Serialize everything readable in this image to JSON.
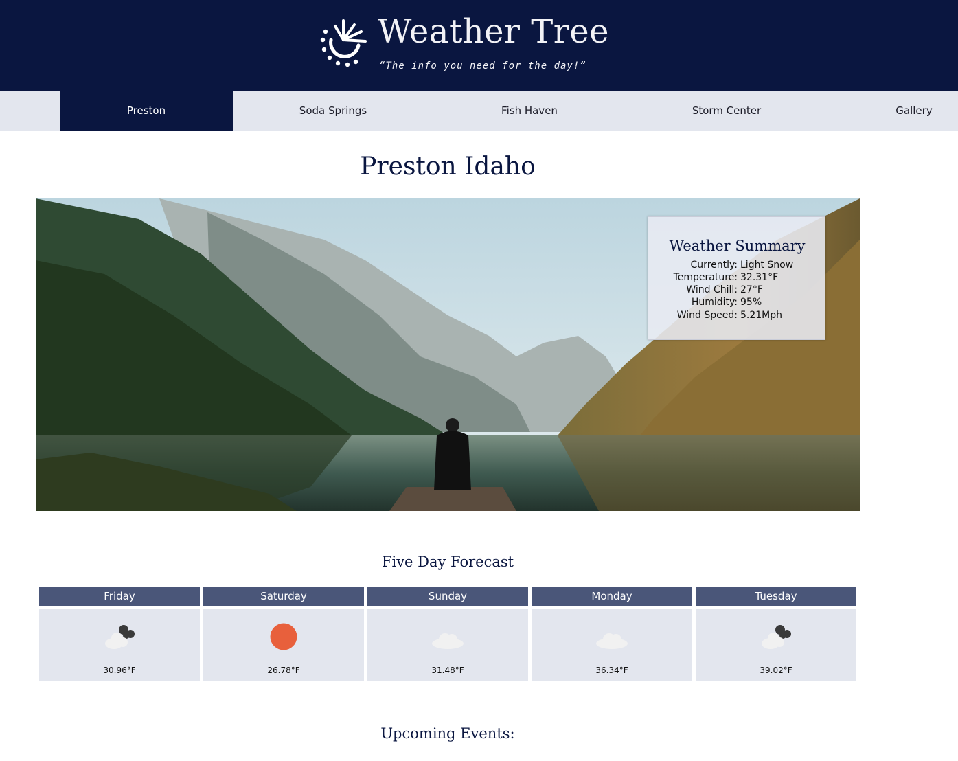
{
  "header": {
    "logo_icon": "sun-burst-icon",
    "title": "Weather Tree",
    "tagline": "“The info you need for the day!”"
  },
  "nav": {
    "items": [
      {
        "label": "Preston",
        "active": true
      },
      {
        "label": "Soda Springs",
        "active": false
      },
      {
        "label": "Fish Haven",
        "active": false
      },
      {
        "label": "Storm Center",
        "active": false
      },
      {
        "label": "Gallery",
        "active": false
      }
    ]
  },
  "main": {
    "page_title": "Preston Idaho",
    "hero_image": "mountain-lake-photo"
  },
  "summary": {
    "title": "Weather Summary",
    "rows": [
      {
        "label": "Currently:",
        "value": "Light Snow"
      },
      {
        "label": "Temperature:",
        "value": "32.31°F"
      },
      {
        "label": "Wind Chill:",
        "value": "27°F"
      },
      {
        "label": "Humidity:",
        "value": "95%"
      },
      {
        "label": "Wind Speed:",
        "value": "5.21Mph"
      }
    ]
  },
  "forecast": {
    "title": "Five Day Forecast",
    "days": [
      {
        "day": "Friday",
        "icon": "partly-cloudy-night-icon",
        "temp": "30.96°F"
      },
      {
        "day": "Saturday",
        "icon": "sun-icon",
        "temp": "26.78°F"
      },
      {
        "day": "Sunday",
        "icon": "cloud-icon",
        "temp": "31.48°F"
      },
      {
        "day": "Monday",
        "icon": "cloud-icon",
        "temp": "36.34°F"
      },
      {
        "day": "Tuesday",
        "icon": "partly-cloudy-night-icon",
        "temp": "39.02°F"
      }
    ]
  },
  "events": {
    "title": "Upcoming Events:"
  },
  "colors": {
    "header_bg": "#0a1640",
    "nav_bg": "#e3e6ee",
    "day_header_bg": "#4a5679",
    "sun": "#e8603c"
  }
}
